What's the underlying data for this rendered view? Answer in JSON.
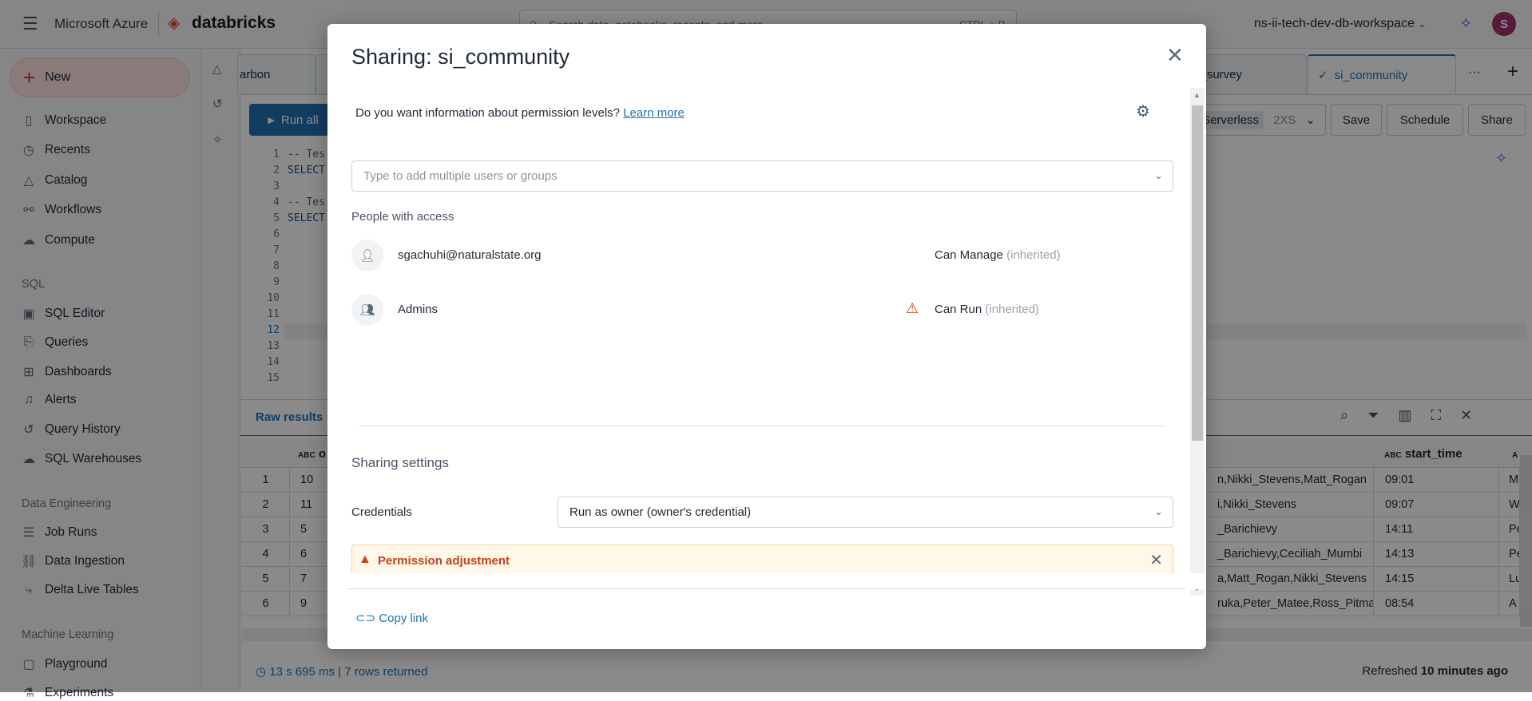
{
  "header": {
    "menu_icon": "hamburger-icon",
    "brand_azure": "Microsoft Azure",
    "brand_databricks": "databricks",
    "search_placeholder": "Search data, notebooks, recents, and more...",
    "search_shortcut": "CTRL + P",
    "workspace": "ns-ii-tech-dev-db-workspace",
    "avatar_initial": "S",
    "avatar_color": "#a1306e"
  },
  "sidebar": {
    "new_label": "New",
    "items": [
      {
        "label": "Workspace",
        "icon": "notebook-icon"
      },
      {
        "label": "Recents",
        "icon": "clock-icon"
      },
      {
        "label": "Catalog",
        "icon": "catalog-icon"
      },
      {
        "label": "Workflows",
        "icon": "workflows-icon"
      },
      {
        "label": "Compute",
        "icon": "cloud-icon"
      }
    ],
    "sql_label": "SQL",
    "sql_items": [
      {
        "label": "SQL Editor"
      },
      {
        "label": "Queries"
      },
      {
        "label": "Dashboards"
      },
      {
        "label": "Alerts"
      },
      {
        "label": "Query History"
      },
      {
        "label": "SQL Warehouses"
      }
    ],
    "de_label": "Data Engineering",
    "de_items": [
      {
        "label": "Job Runs"
      },
      {
        "label": "Data Ingestion"
      },
      {
        "label": "Delta Live Tables"
      }
    ],
    "ml_label": "Machine Learning",
    "ml_items": [
      {
        "label": "Playground"
      },
      {
        "label": "Experiments"
      }
    ]
  },
  "tabs": [
    {
      "label": "arbon"
    },
    {
      "label": "yer_survey"
    },
    {
      "label": "si_community",
      "active": true
    }
  ],
  "tabs_more": "···",
  "tabs_add": "+",
  "toolbar": {
    "run_all": "Run all",
    "compute": "Serverless",
    "size": "2XS",
    "save": "Save",
    "schedule": "Schedule",
    "share": "Share"
  },
  "editor": {
    "lines": [
      "1",
      "2",
      "3",
      "4",
      "5",
      "6",
      "7",
      "8",
      "9",
      "10",
      "11",
      "12",
      "13",
      "14",
      "15"
    ],
    "code": [
      "-- Tes",
      "SELECT",
      "",
      "-- Tes",
      "SELECT"
    ],
    "current_line": "12"
  },
  "results": {
    "tab": "Raw results",
    "col2_header": "o",
    "col_start_time": "start_time",
    "col_last": "A",
    "rows": [
      {
        "n": "1",
        "c2": "10",
        "names": "n,Nikki_Stevens,Matt_Rogan",
        "time": "09:01",
        "last": "M"
      },
      {
        "n": "2",
        "c2": "11",
        "names": "i,Nikki_Stevens",
        "time": "09:07",
        "last": "W"
      },
      {
        "n": "3",
        "c2": "5",
        "names": "_Barichievy",
        "time": "14:11",
        "last": "Pe"
      },
      {
        "n": "4",
        "c2": "6",
        "names": "_Barichievy,Ceciliah_Mumbi",
        "time": "14:13",
        "last": "Pe"
      },
      {
        "n": "5",
        "c2": "7",
        "names": "a,Matt_Rogan,Nikki_Stevens",
        "time": "14:15",
        "last": "Lu"
      },
      {
        "n": "6",
        "c2": "9",
        "names": "ruka,Peter_Matee,Ross_Pitman",
        "time": "08:54",
        "last": "A"
      }
    ],
    "status": "13 s 695 ms | 7 rows returned",
    "refreshed_prefix": "Refreshed ",
    "refreshed_value": "10 minutes ago"
  },
  "modal": {
    "title": "Sharing: si_community",
    "info": "Do you want information about permission levels?",
    "learn_more": "Learn more",
    "input_placeholder": "Type to add multiple users or groups",
    "people_label": "People with access",
    "people": [
      {
        "name": "sgachuhi@naturalstate.org",
        "permission": "Can Manage",
        "note": "(inherited)",
        "icon": "user-icon",
        "warning": false
      },
      {
        "name": "Admins",
        "permission": "Can Run",
        "note": "(inherited)",
        "icon": "group-icon",
        "warning": true
      }
    ],
    "sharing_settings": "Sharing settings",
    "credentials_label": "Credentials",
    "credentials_value": "Run as owner (owner's credential)",
    "alert_title": "Permission adjustment",
    "copy_link": "Copy link",
    "warning_color": "#c4431b",
    "link_color": "#2272b4"
  }
}
